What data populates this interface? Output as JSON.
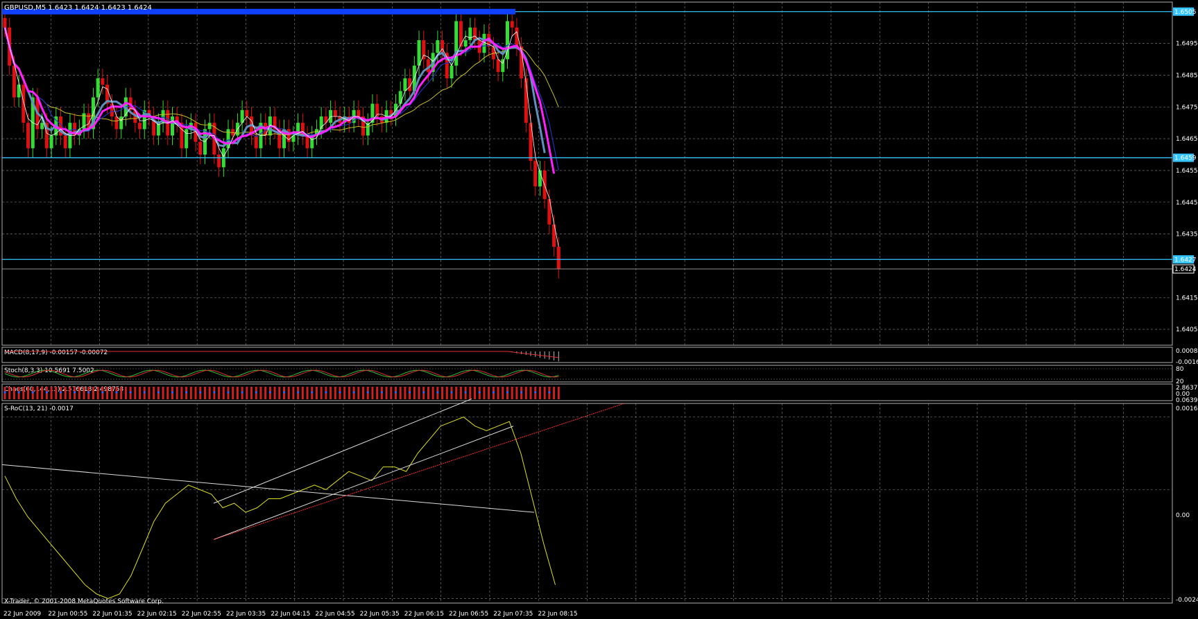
{
  "window": {
    "background": "#000000",
    "grid_color": "#8a8a8a"
  },
  "chart_data": {
    "type": "candlestick",
    "symbol_header": "GBPUSD,M5  1.6423 1.6424 1.6423 1.6424",
    "ylim": [
      1.64,
      1.6508
    ],
    "y_ticks": [
      "1.6495",
      "1.6485",
      "1.6475",
      "1.6465",
      "1.6455",
      "1.6445",
      "1.6435",
      "1.6415",
      "1.6405"
    ],
    "y_tick_values": [
      1.6495,
      1.6485,
      1.6475,
      1.6465,
      1.6455,
      1.6445,
      1.6435,
      1.6415,
      1.6405
    ],
    "x_ticks": [
      "22 Jun 2009",
      "22 Jun 00:55",
      "22 Jun 01:35",
      "22 Jun 02:15",
      "22 Jun 02:55",
      "22 Jun 03:35",
      "22 Jun 04:15",
      "22 Jun 04:55",
      "22 Jun 05:35",
      "22 Jun 06:15",
      "22 Jun 06:55",
      "22 Jun 07:35",
      "22 Jun 08:15"
    ],
    "horizontal_levels": [
      {
        "label": "1.6505",
        "value": 1.6505,
        "color": "#35c6ff"
      },
      {
        "label": "1.6459",
        "value": 1.6459,
        "color": "#35c6ff"
      },
      {
        "label": "1.6427",
        "value": 1.6427,
        "color": "#35c6ff"
      }
    ],
    "bid_line": {
      "label": "1.6424",
      "value": 1.6424
    },
    "closes": [
      1.65,
      1.6488,
      1.6478,
      1.6482,
      1.647,
      1.6462,
      1.6478,
      1.6468,
      1.647,
      1.6462,
      1.6466,
      1.6472,
      1.6466,
      1.6462,
      1.647,
      1.6466,
      1.6468,
      1.6473,
      1.6468,
      1.6478,
      1.6484,
      1.6482,
      1.6476,
      1.6472,
      1.6468,
      1.6472,
      1.6478,
      1.6474,
      1.647,
      1.6468,
      1.6474,
      1.6472,
      1.6466,
      1.647,
      1.6474,
      1.6466,
      1.6472,
      1.647,
      1.6462,
      1.6468,
      1.647,
      1.6464,
      1.646,
      1.6468,
      1.647,
      1.646,
      1.6456,
      1.6462,
      1.6468,
      1.6466,
      1.647,
      1.6474,
      1.6472,
      1.6466,
      1.6462,
      1.647,
      1.6466,
      1.6472,
      1.6468,
      1.6462,
      1.6468,
      1.6464,
      1.6466,
      1.647,
      1.6466,
      1.6462,
      1.6466,
      1.6468,
      1.6472,
      1.647,
      1.6474,
      1.6472,
      1.647,
      1.6472,
      1.647,
      1.6474,
      1.6472,
      1.6466,
      1.647,
      1.6476,
      1.6472,
      1.647,
      1.6474,
      1.6472,
      1.6476,
      1.648,
      1.6484,
      1.648,
      1.6488,
      1.6496,
      1.649,
      1.6486,
      1.6492,
      1.6496,
      1.6492,
      1.6484,
      1.6488,
      1.6502,
      1.6494,
      1.6496,
      1.65,
      1.6496,
      1.6492,
      1.6498,
      1.6494,
      1.649,
      1.6486,
      1.649,
      1.6502,
      1.65,
      1.6494,
      1.6484,
      1.647,
      1.6458,
      1.645,
      1.6455,
      1.6446,
      1.6438,
      1.6431,
      1.6424
    ],
    "indicators": [
      {
        "text": "MACD(8,17,9) -0.00157 -0.00072",
        "axis": [
          "0.00086",
          "-0.00169"
        ]
      },
      {
        "text": "Stoch(8,3,3) 10.5691 7.5002",
        "axis": [
          "80",
          "20"
        ]
      },
      {
        "text": "Chaos(60,144,13) 2.576618 2.498758",
        "axis": [
          "2.86372",
          "0.00",
          "0.06398"
        ]
      },
      {
        "text": "S-RoC(13, 21) -0.0017",
        "axis": [
          "0.0016",
          "0.00",
          "-0.0024"
        ]
      }
    ],
    "sroc_values": [
      0.0003,
      -0.0002,
      -0.0006,
      -0.0009,
      -0.0012,
      -0.0015,
      -0.0018,
      -0.0021,
      -0.0023,
      -0.0024,
      -0.0023,
      -0.0019,
      -0.0013,
      -0.0007,
      -0.0003,
      -0.0001,
      0.0001,
      0.0,
      -0.0001,
      -0.0004,
      -0.0003,
      -0.0005,
      -0.0004,
      -0.0002,
      -0.0002,
      -0.0001,
      0.0,
      0.0001,
      0.0,
      0.0002,
      0.0004,
      0.0003,
      0.0002,
      0.0005,
      0.0005,
      0.0004,
      0.0008,
      0.0011,
      0.0014,
      0.0015,
      0.0016,
      0.0014,
      0.0013,
      0.0014,
      0.0015,
      0.0008,
      -0.0002,
      -0.0012,
      -0.0021
    ],
    "sroc_ylim": [
      -0.0025,
      0.0019
    ],
    "footer": "X-Trader, © 2001-2008 MetaQuotes Software Corp."
  }
}
